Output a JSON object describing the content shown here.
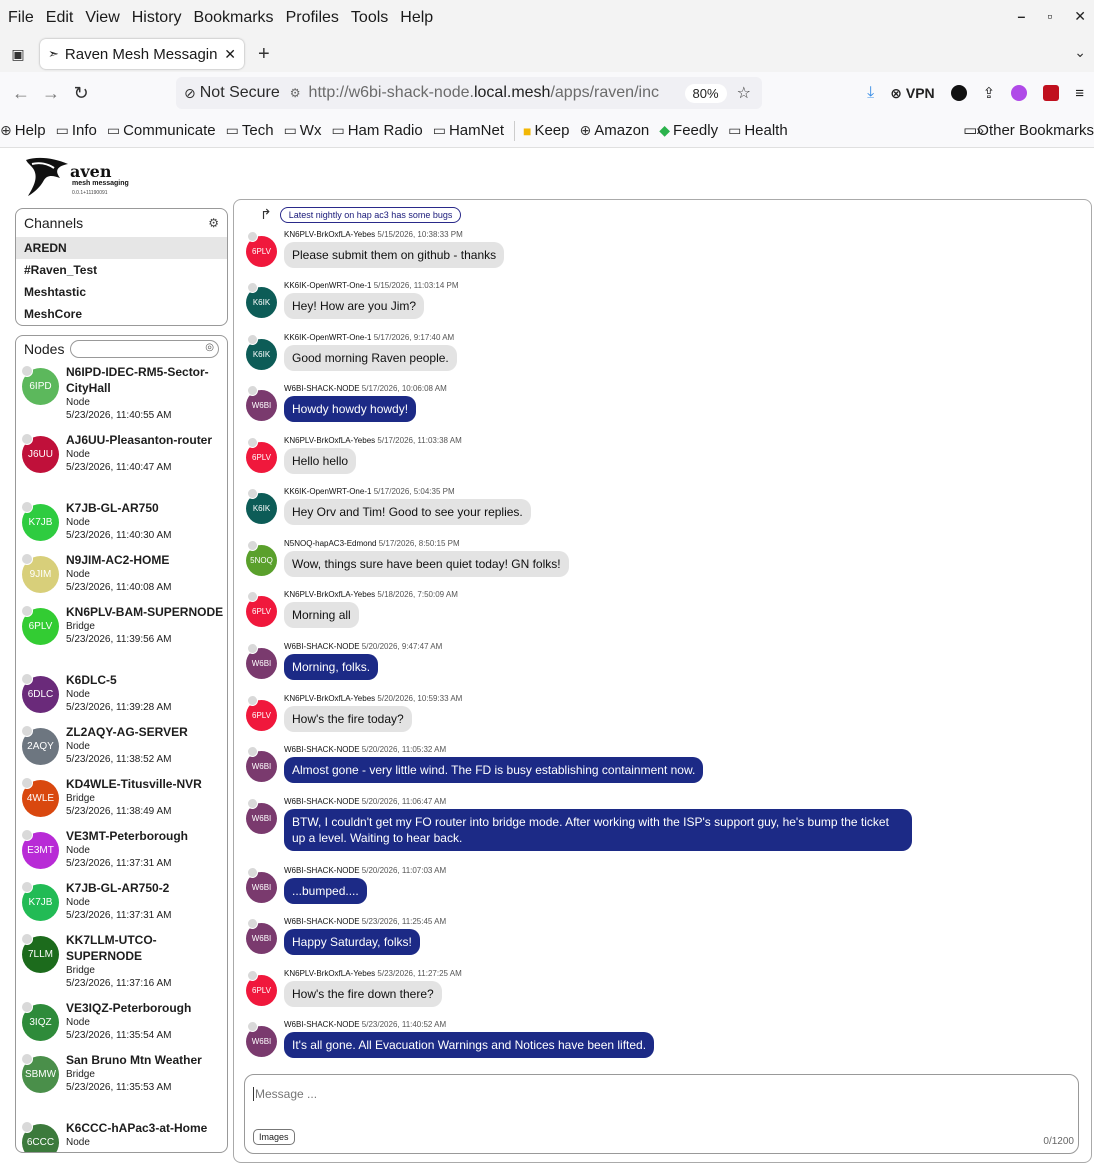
{
  "browser": {
    "menu": [
      "File",
      "Edit",
      "View",
      "History",
      "Bookmarks",
      "Profiles",
      "Tools",
      "Help"
    ],
    "tab_title": "Raven Mesh Messagin",
    "not_secure": "Not Secure",
    "url_prefix": "http://w6bi-shack-node.",
    "url_domain": "local.mesh",
    "url_suffix": "/apps/raven/inc",
    "zoom": "80%",
    "vpn": "VPN",
    "bookmarks": [
      {
        "icon": "globe-icon",
        "label": "Help"
      },
      {
        "icon": "folder-icon",
        "label": "Info"
      },
      {
        "icon": "folder-icon",
        "label": "Communicate"
      },
      {
        "icon": "folder-icon",
        "label": "Tech"
      },
      {
        "icon": "folder-icon",
        "label": "Wx"
      },
      {
        "icon": "folder-icon",
        "label": "Ham Radio"
      },
      {
        "icon": "folder-icon",
        "label": "HamNet"
      },
      {
        "icon": "keep-icon",
        "label": "Keep"
      },
      {
        "icon": "globe-icon",
        "label": "Amazon"
      },
      {
        "icon": "feedly-icon",
        "label": "Feedly"
      },
      {
        "icon": "folder-icon",
        "label": "Health"
      }
    ],
    "other_bookmarks": "Other Bookmarks"
  },
  "app": {
    "brand": "aven",
    "tagline": "mesh messaging",
    "version": "0.0.1+11190091"
  },
  "channels": {
    "title": "Channels",
    "items": [
      "AREDN",
      "#Raven_Test",
      "Meshtastic",
      "MeshCore"
    ]
  },
  "nodes": {
    "title": "Nodes",
    "items": [
      {
        "abbr": "6IPD",
        "color": "#5cb85c",
        "name": "N6IPD-IDEC-RM5-Sector-CityHall",
        "type": "Node",
        "time": "5/23/2026, 11:40:55 AM"
      },
      {
        "abbr": "J6UU",
        "color": "#c0103a",
        "name": "AJ6UU-Pleasanton-router",
        "type": "Node",
        "time": "5/23/2026, 11:40:47 AM"
      },
      {
        "abbr": "K7JB",
        "color": "#2ecc40",
        "name": "K7JB-GL-AR750",
        "type": "Node",
        "time": "5/23/2026, 11:40:30 AM"
      },
      {
        "abbr": "9JIM",
        "color": "#d8cf7a",
        "name": "N9JIM-AC2-HOME",
        "type": "Node",
        "time": "5/23/2026, 11:40:08 AM"
      },
      {
        "abbr": "6PLV",
        "color": "#33cc33",
        "name": "KN6PLV-BAM-SUPERNODE",
        "type": "Bridge",
        "time": "5/23/2026, 11:39:56 AM"
      },
      {
        "abbr": "6DLC",
        "color": "#6a2a7a",
        "name": "K6DLC-5",
        "type": "Node",
        "time": "5/23/2026, 11:39:28 AM"
      },
      {
        "abbr": "2AQY",
        "color": "#6d7680",
        "name": "ZL2AQY-AG-SERVER",
        "type": "Node",
        "time": "5/23/2026, 11:38:52 AM"
      },
      {
        "abbr": "4WLE",
        "color": "#d9480f",
        "name": "KD4WLE-Titusville-NVR",
        "type": "Bridge",
        "time": "5/23/2026, 11:38:49 AM"
      },
      {
        "abbr": "E3MT",
        "color": "#b82bd6",
        "name": "VE3MT-Peterborough",
        "type": "Node",
        "time": "5/23/2026, 11:37:31 AM"
      },
      {
        "abbr": "K7JB",
        "color": "#22bb55",
        "name": "K7JB-GL-AR750-2",
        "type": "Node",
        "time": "5/23/2026, 11:37:31 AM"
      },
      {
        "abbr": "7LLM",
        "color": "#1c6b1c",
        "name": "KK7LLM-UTCO-SUPERNODE",
        "type": "Bridge",
        "time": "5/23/2026, 11:37:16 AM"
      },
      {
        "abbr": "3IQZ",
        "color": "#2e8b3a",
        "name": "VE3IQZ-Peterborough",
        "type": "Node",
        "time": "5/23/2026, 11:35:54 AM"
      },
      {
        "abbr": "SBMW",
        "color": "#4a8f4a",
        "name": "San Bruno Mtn Weather",
        "type": "Bridge",
        "time": "5/23/2026, 11:35:53 AM"
      },
      {
        "abbr": "6CCC",
        "color": "#3c7a3c",
        "name": "K6CCC-hAPac3-at-Home",
        "type": "Node",
        "time": ""
      }
    ]
  },
  "chat": {
    "reply_preview": "Latest nightly on hap ac3 has some bugs",
    "messages": [
      {
        "abbr": "6PLV",
        "color": "#f0183c",
        "from": "KN6PLV-BrkOxfLA-Yebes",
        "ts": "5/15/2026, 10:38:33 PM",
        "text": "Please submit them on github - thanks",
        "self": false
      },
      {
        "abbr": "K6IK",
        "color": "#0d5c57",
        "from": "KK6IK-OpenWRT-One-1",
        "ts": "5/15/2026, 11:03:14 PM",
        "text": "Hey!  How are you Jim?",
        "self": false
      },
      {
        "abbr": "K6IK",
        "color": "#0d5c57",
        "from": "KK6IK-OpenWRT-One-1",
        "ts": "5/17/2026, 9:17:40 AM",
        "text": "Good morning Raven people.",
        "self": false
      },
      {
        "abbr": "W6BI",
        "color": "#7a3a6e",
        "from": "W6BI-SHACK-NODE",
        "ts": "5/17/2026, 10:06:08 AM",
        "text": "Howdy howdy howdy!",
        "self": true
      },
      {
        "abbr": "6PLV",
        "color": "#f0183c",
        "from": "KN6PLV-BrkOxfLA-Yebes",
        "ts": "5/17/2026, 11:03:38 AM",
        "text": "Hello hello",
        "self": false
      },
      {
        "abbr": "K6IK",
        "color": "#0d5c57",
        "from": "KK6IK-OpenWRT-One-1",
        "ts": "5/17/2026, 5:04:35 PM",
        "text": "Hey Orv and Tim!  Good to see your replies.",
        "self": false
      },
      {
        "abbr": "5NOQ",
        "color": "#5aa02c",
        "from": "N5NOQ-hapAC3-Edmond",
        "ts": "5/17/2026, 8:50:15 PM",
        "text": "Wow, things sure have been quiet today!  GN folks!",
        "self": false
      },
      {
        "abbr": "6PLV",
        "color": "#f0183c",
        "from": "KN6PLV-BrkOxfLA-Yebes",
        "ts": "5/18/2026, 7:50:09 AM",
        "text": "Morning all",
        "self": false
      },
      {
        "abbr": "W6BI",
        "color": "#7a3a6e",
        "from": "W6BI-SHACK-NODE",
        "ts": "5/20/2026, 9:47:47 AM",
        "text": "Morning, folks.",
        "self": true
      },
      {
        "abbr": "6PLV",
        "color": "#f0183c",
        "from": "KN6PLV-BrkOxfLA-Yebes",
        "ts": "5/20/2026, 10:59:33 AM",
        "text": "How's the fire today?",
        "self": false
      },
      {
        "abbr": "W6BI",
        "color": "#7a3a6e",
        "from": "W6BI-SHACK-NODE",
        "ts": "5/20/2026, 11:05:32 AM",
        "text": "Almost gone - very little wind.  The FD is busy establishing containment now.",
        "self": true
      },
      {
        "abbr": "W6BI",
        "color": "#7a3a6e",
        "from": "W6BI-SHACK-NODE",
        "ts": "5/20/2026, 11:06:47 AM",
        "text": "BTW, I couldn't get my FO router into bridge mode.  After working with the ISP's support guy, he's bump the ticket up a level.  Waiting to hear back.",
        "self": true
      },
      {
        "abbr": "W6BI",
        "color": "#7a3a6e",
        "from": "W6BI-SHACK-NODE",
        "ts": "5/20/2026, 11:07:03 AM",
        "text": "...bumped....",
        "self": true
      },
      {
        "abbr": "W6BI",
        "color": "#7a3a6e",
        "from": "W6BI-SHACK-NODE",
        "ts": "5/23/2026, 11:25:45 AM",
        "text": "Happy Saturday, folks!",
        "self": true
      },
      {
        "abbr": "6PLV",
        "color": "#f0183c",
        "from": "KN6PLV-BrkOxfLA-Yebes",
        "ts": "5/23/2026, 11:27:25 AM",
        "text": "How's the fire down there?",
        "self": false
      },
      {
        "abbr": "W6BI",
        "color": "#7a3a6e",
        "from": "W6BI-SHACK-NODE",
        "ts": "5/23/2026, 11:40:52 AM",
        "text": "It's all gone.  All Evacuation Warnings and Notices have been lifted.",
        "self": true
      }
    ],
    "composer": {
      "placeholder": "Message ...",
      "images_label": "Images",
      "counter": "0/1200"
    }
  }
}
